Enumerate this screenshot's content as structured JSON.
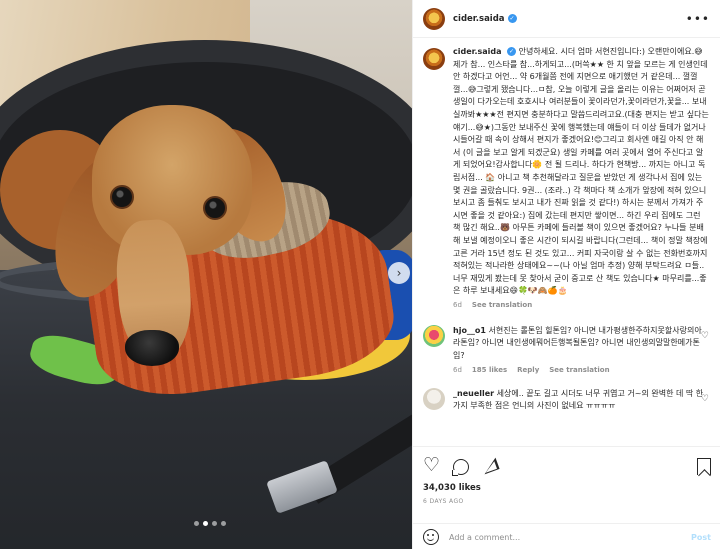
{
  "post": {
    "username": "cider.saida",
    "more_label": "•••",
    "photo_dots": [
      false,
      true,
      false,
      false
    ],
    "next_label": "›"
  },
  "caption": {
    "username": "cider.saida",
    "text": "안녕하세요. 시더 엄마 서현진입니다:) 오랜만이에요.😅제가 참... 인스타를 참...하게되고...(머쓱★★ 한 치 앞을 모르는 게 인생인데 안 하겠다고 어언... 약 6개월쯤 전에 지면으로 애기했던 거 같은데... 껄껄껄...😅그렇게 됐습니다...ㅁ참, 오늘 이렇게 글을 올리는 이유는 어쩌어저 곧 생일이 다가오는데 호호시나 여러분들이 꽃이라던가,꽃이라던가,꽃을... 보내실까봐★★★전 편지면 충분하다고 말씀드리려고요.(대충 편지는 받고 싶다는 얘기...😅★)그동안 보내주신 꽃에 행복했는데 얘들이 더 이상 들데가 없거나 시들어갈 때 속이 상해서 편지가 좋겠어요!😊그리고 회사엔 애길 아직 안 해서 (이 글을 보고 알게 되겠군요) 생일 카페를 여러 곳에서 열어 주신다고 알게 되었어요!감사합니다🌼 전 될 드리나. 하다가 현책방... 까지는 아니고 독립서점... 🏠 아니고 책 추천해달라고 질문을 받았던 게 생각나서 집에 있는 몇 권을 골랐습니다. 9권... (조라..) 각 책마다 책 소개가 앞장에 적혀 있으니 보시고 좀 들춰도 보시고 내가 진짜 읽을 것 같다!) 하시는 분께서 가져가 주시면 좋을 것 같아요:) 집에 갔는데 편지만 쌓이면... 하긴 우리 집에도 그런 책 많긴 해요..🐻 아무튼 카페에 들러볼 책이 있으면 좋겠어요? 누나들 분배해 보낼 예정이오니 좋은 시간이 되시길 바랍니다(그런데... 책이 정말 책장에 고른 거라 15년 정도 된 것도 있고... 커피 자국이랑 살 수 없는 전화번호까지 적혀있는 적나라한 상태에요~~(나 아닐 엄마 추정) 양해 부탁드려요 ㅁ들.. 너무 재밌게 봤는데 못 찾아서 굳이 중고로 산 책도 있습니다★ 마무리를...좋은 하루 보내세요😄🍀🐶🙈🍊🎂",
    "age": "6d",
    "see_translation": "See translation"
  },
  "comments": [
    {
      "username": "hjo__o1",
      "text": "서현진는 롤톤임 힐톤임? 아니면 내가평생한주하지못할사랑의아라톤임? 아니면 내인생에뭐어든행복될톤임? 아니면 내인생의말말한메가톤임?",
      "age": "6d",
      "likes": "185 likes",
      "reply": "Reply",
      "see_translation": "See translation"
    },
    {
      "username": "_neueller",
      "text": "세상에.. 끝도 길고 시더도 너무 귀엽고 거~의 완벽한 데 딱 한가지 부족한 점은 언니의 사진이 없네요 ㅠㅠㅠㅠ",
      "age": "",
      "likes": "",
      "reply": "",
      "see_translation": ""
    }
  ],
  "likes": "34,030 likes",
  "timestamp": "6 DAYS AGO",
  "add_comment": {
    "placeholder": "Add a comment...",
    "post_label": "Post"
  }
}
